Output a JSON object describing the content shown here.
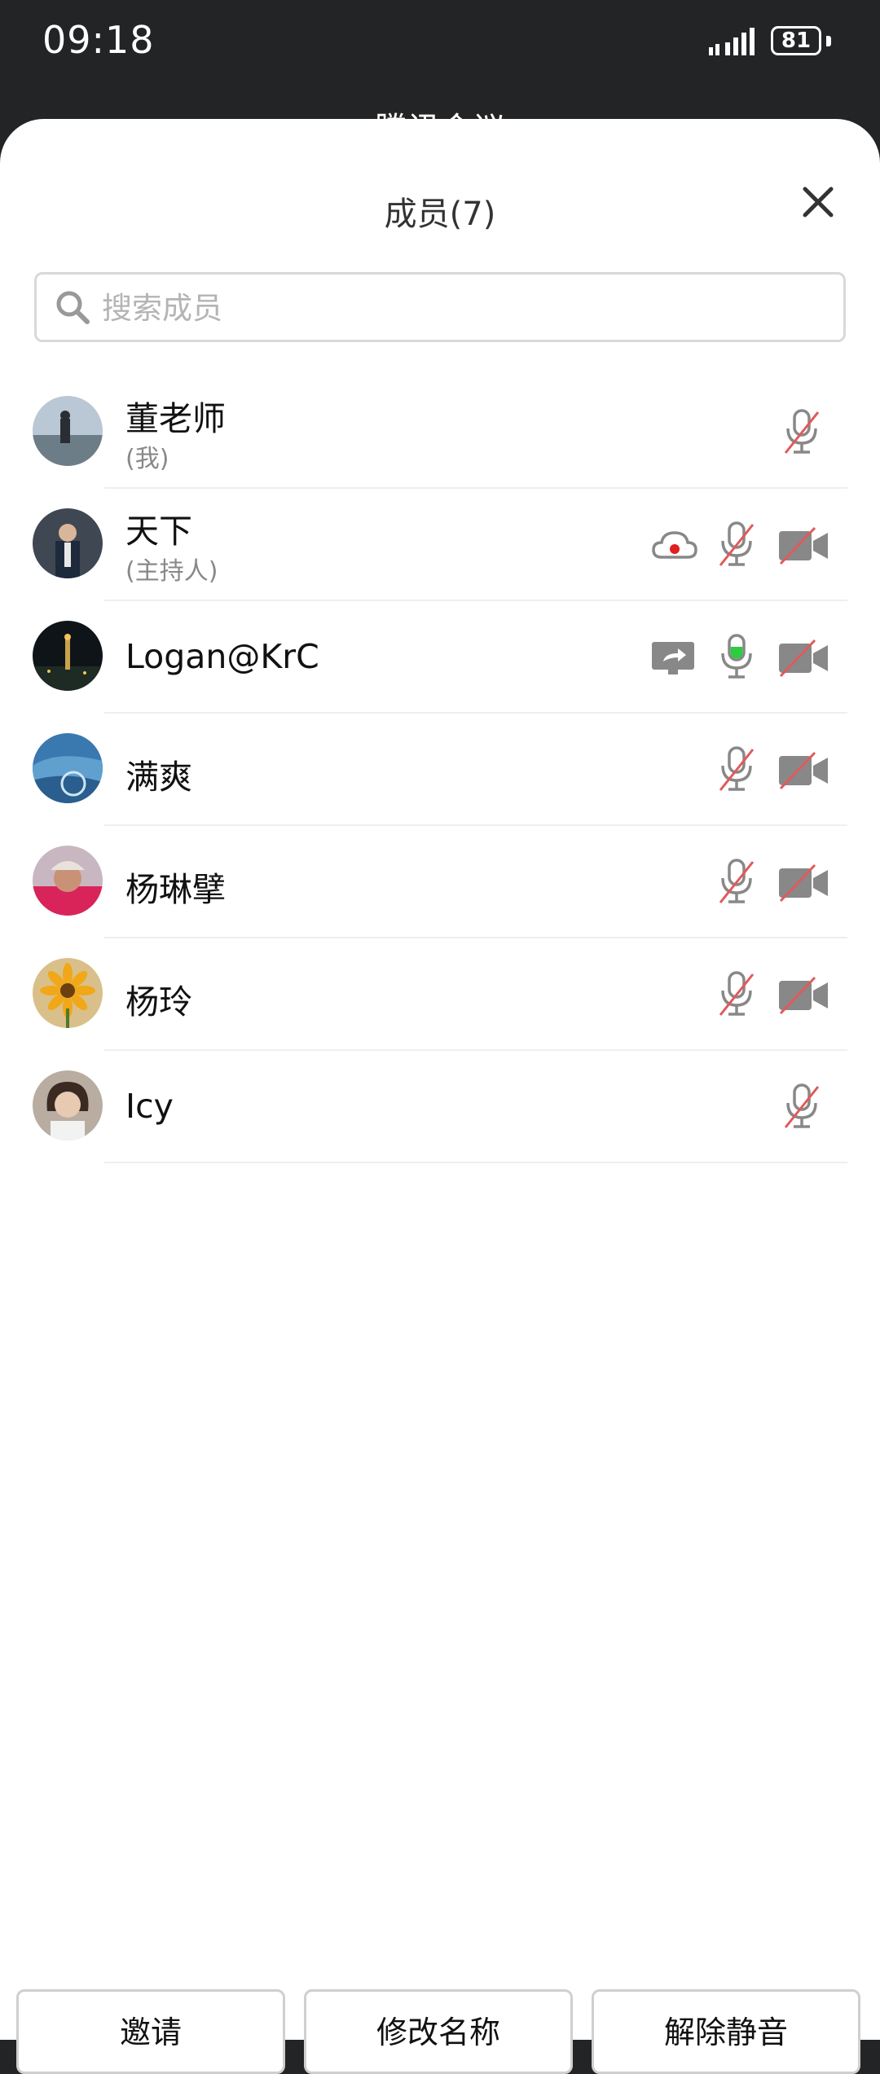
{
  "status_bar": {
    "time": "09:18",
    "battery": "81"
  },
  "background_title": "腾讯会议",
  "panel": {
    "title": "成员(7)",
    "search_placeholder": "搜索成员"
  },
  "members": [
    {
      "name": "董老师",
      "role": "(我)"
    },
    {
      "name": "天下",
      "role": "(主持人)"
    },
    {
      "name": "Logan@KrC",
      "role": ""
    },
    {
      "name": "满爽",
      "role": ""
    },
    {
      "name": "杨琳擘",
      "role": ""
    },
    {
      "name": "杨玲",
      "role": ""
    },
    {
      "name": "Icy",
      "role": ""
    }
  ],
  "icons": {
    "mic_muted": "microphone-muted-icon",
    "mic_active": "microphone-active-icon",
    "cam_off": "camera-off-icon",
    "cloud_record": "cloud-recording-icon",
    "screen_share": "screen-share-icon"
  },
  "colors": {
    "muted_slash": "#e05a5a",
    "mic_active_level": "#2ecc40",
    "recording_dot": "#e02020"
  },
  "footer": {
    "invite": "邀请",
    "rename": "修改名称",
    "unmute": "解除静音"
  }
}
